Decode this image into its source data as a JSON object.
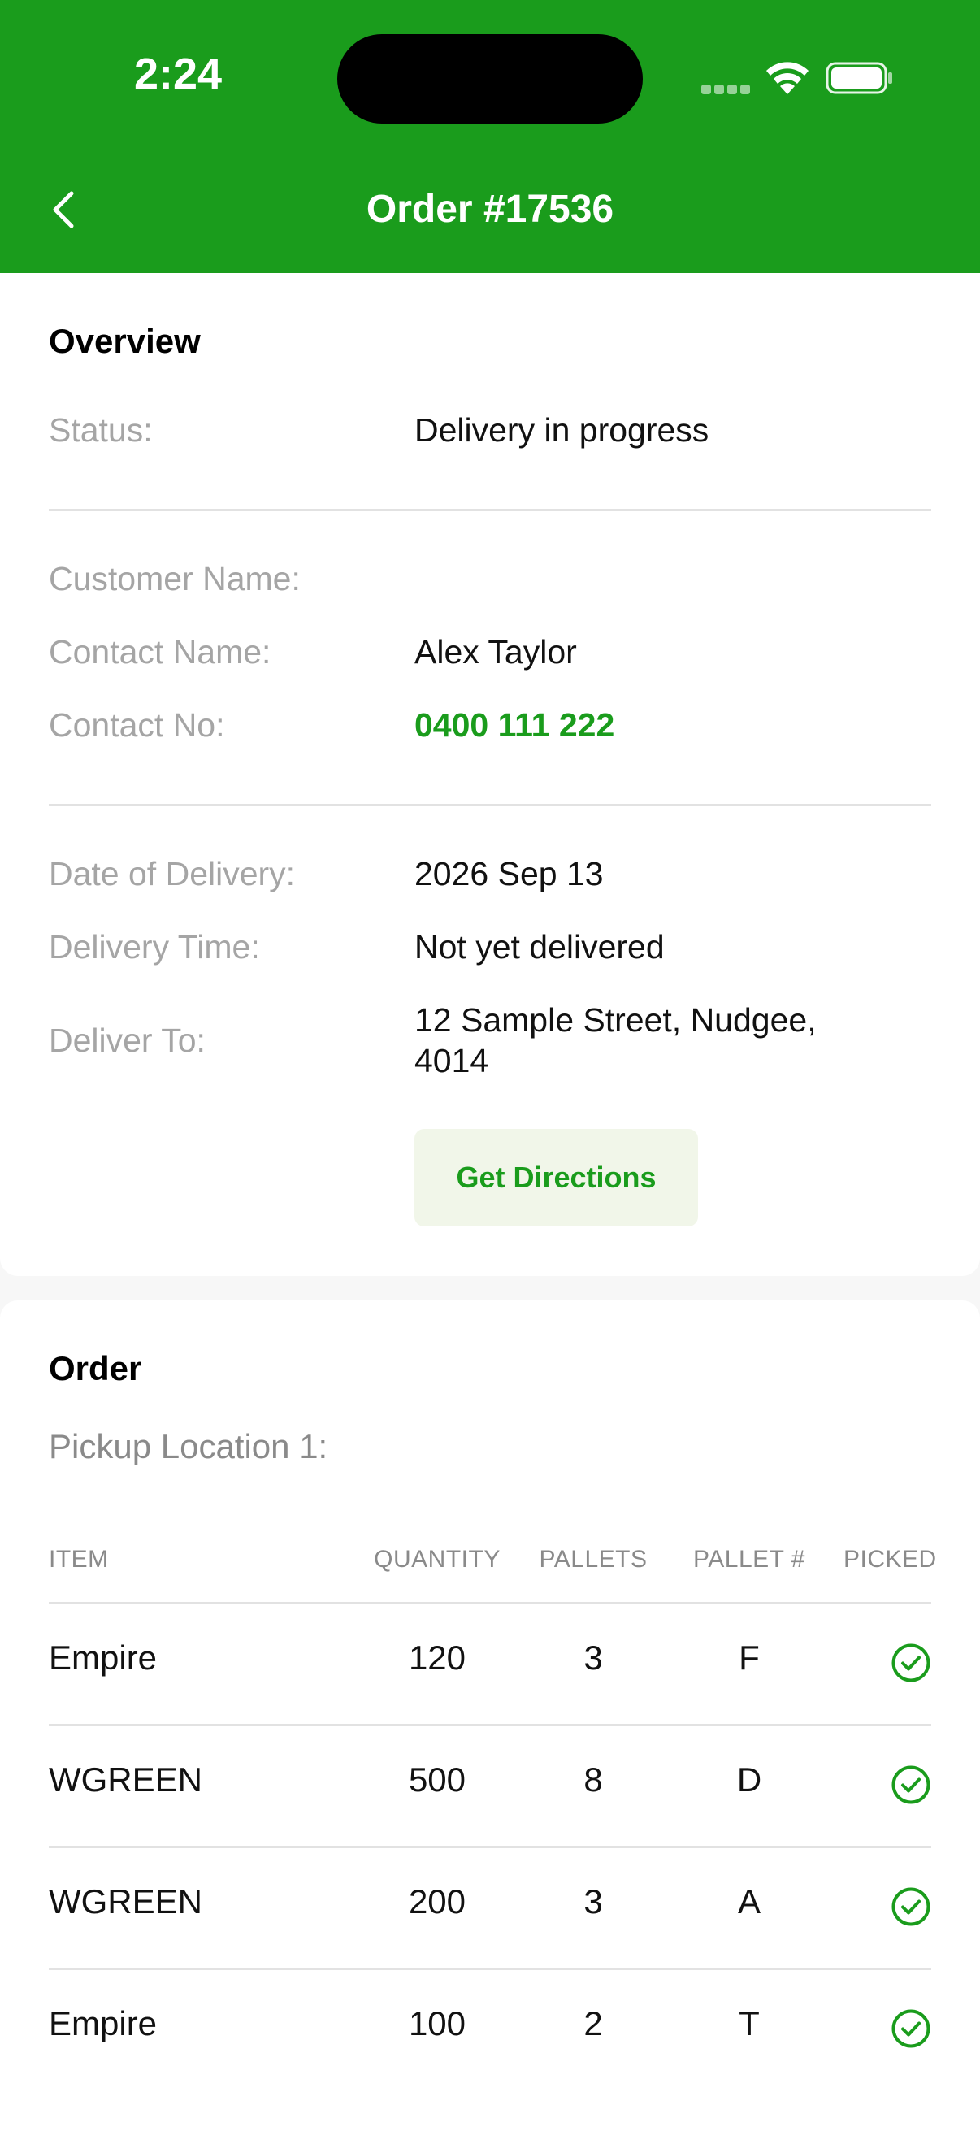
{
  "status_bar": {
    "time": "2:24"
  },
  "nav": {
    "title": "Order #17536"
  },
  "overview": {
    "title": "Overview",
    "status_label": "Status:",
    "status_value": "Delivery in progress",
    "customer_label": "Customer Name:",
    "customer_value": "",
    "contact_label": "Contact Name:",
    "contact_value": "Alex Taylor",
    "phone_label": "Contact No:",
    "phone_value": "0400 111 222",
    "date_label": "Date of Delivery:",
    "date_value": "2026 Sep 13",
    "time_label": "Delivery Time:",
    "time_value": "Not yet delivered",
    "deliver_label": "Deliver To:",
    "deliver_line1": "12 Sample Street, Nudgee,",
    "deliver_line2": "4014",
    "directions_label": "Get Directions"
  },
  "order": {
    "title": "Order",
    "pickup_label": "Pickup Location 1:",
    "columns": [
      "ITEM",
      "QUANTITY",
      "PALLETS",
      "PALLET #",
      "PICKED"
    ],
    "rows": [
      {
        "item": "Empire",
        "quantity": "120",
        "pallets": "3",
        "pallet_no": "F",
        "picked": true
      },
      {
        "item": "WGREEN",
        "quantity": "500",
        "pallets": "8",
        "pallet_no": "D",
        "picked": true
      },
      {
        "item": "WGREEN",
        "quantity": "200",
        "pallets": "3",
        "pallet_no": "A",
        "picked": true
      },
      {
        "item": "Empire",
        "quantity": "100",
        "pallets": "2",
        "pallet_no": "T",
        "picked": true
      }
    ]
  },
  "colors": {
    "brand_green": "#1a9c1c",
    "button_bg": "#f1f6e9",
    "label_gray": "#a5a5a5"
  }
}
